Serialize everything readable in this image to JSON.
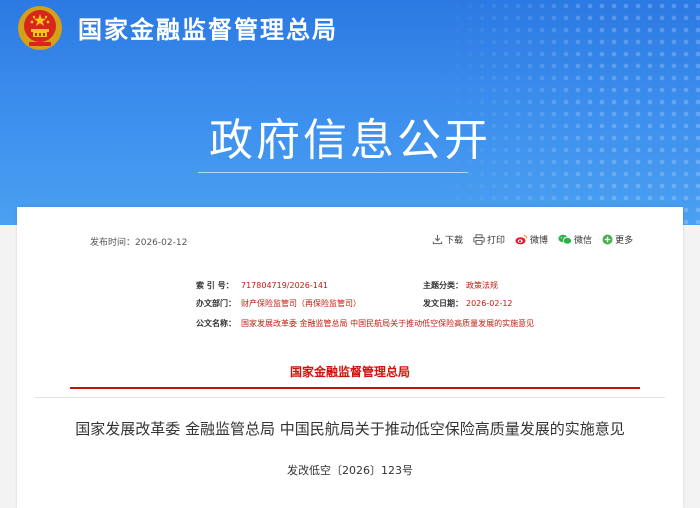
{
  "header": {
    "site_title": "国家金融监督管理总局",
    "banner_title": "政府信息公开"
  },
  "info": {
    "pubdate": "发布时间：2026-02-12"
  },
  "toolbar": {
    "download": "下载",
    "print": "打印",
    "weibo": "微博",
    "wechat": "微信",
    "more": "更多"
  },
  "meta": {
    "index_label": "索 引 号：",
    "index_value": "717804719/2026-141",
    "category_label": "主题分类：",
    "category_value": "政策法规",
    "dept_label": "办文部门：",
    "dept_value": "财产保险监管司（再保险监管司）",
    "date_label": "发文日期：",
    "date_value": "2026-02-12",
    "subject_label": "公文名称：",
    "subject_value": "国家发展改革委 金融监管总局 中国民航局关于推动低空保险高质量发展的实施意见"
  },
  "document": {
    "issuer": "国家金融监督管理总局",
    "title": "国家发展改革委 金融监管总局 中国民航局关于推动低空保险高质量发展的实施意见",
    "number": "发改低空〔2026〕123号"
  },
  "colors": {
    "banner": "#3b8ded",
    "accent_red": "#c41a0f"
  },
  "icons": {
    "emblem": "national-emblem-icon",
    "download": "download-icon",
    "print": "printer-icon",
    "weibo": "weibo-icon",
    "wechat": "wechat-icon",
    "more": "plus-circle-icon"
  }
}
